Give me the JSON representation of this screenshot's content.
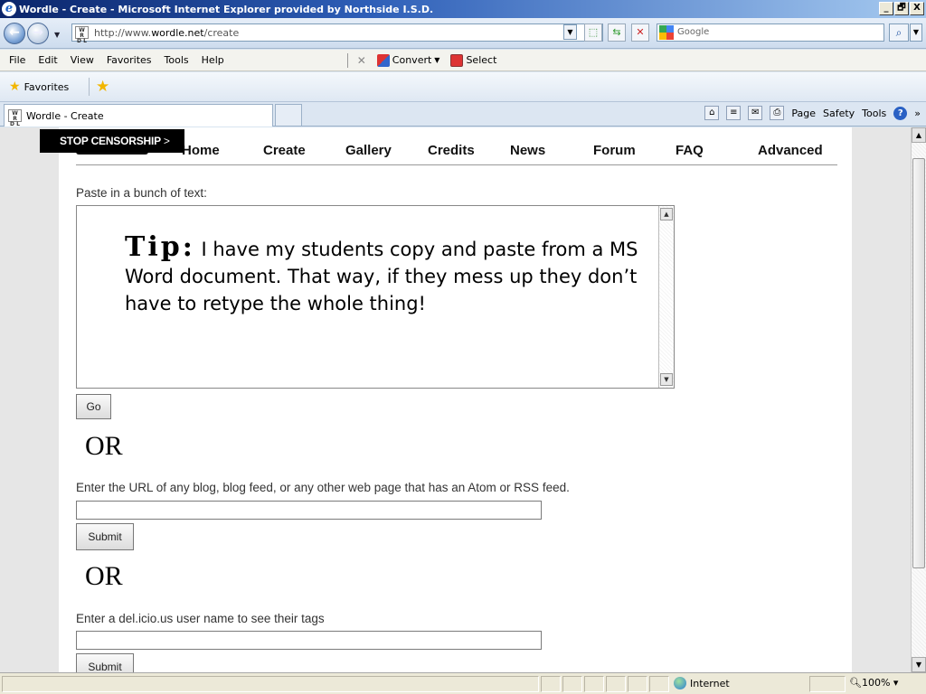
{
  "window": {
    "title": "Wordle - Create - Microsoft Internet Explorer provided by Northside I.S.D.",
    "minimize": "_",
    "maximize": "🗗",
    "close": "X"
  },
  "addressbar": {
    "url_prefix": "http://www.",
    "url_domain": "wordle.net",
    "url_path": "/create",
    "search_placeholder": "Google"
  },
  "menu": {
    "items": [
      "File",
      "Edit",
      "View",
      "Favorites",
      "Tools",
      "Help"
    ],
    "convert_label": "Convert",
    "select_label": "Select"
  },
  "favorites": {
    "label": "Favorites"
  },
  "tab": {
    "title": "Wordle - Create"
  },
  "commandbar": {
    "page": "Page",
    "safety": "Safety",
    "tools": "Tools",
    "more": "»"
  },
  "site": {
    "badge": "STOP CENSORSHIP",
    "badge_chevron": ">",
    "nav": [
      "Home",
      "Create",
      "Gallery",
      "Credits",
      "News",
      "Forum",
      "FAQ",
      "Advanced"
    ]
  },
  "form": {
    "paste_label": "Paste in a bunch of text:",
    "tip_word": "Tip:",
    "tip_text": "I have my students copy and paste from a MS Word document.  That way, if they mess up they don’t have to retype the whole thing!",
    "go_button": "Go",
    "or1": "OR",
    "url_label": "Enter the URL of any blog, blog feed, or any other web page that has an Atom or RSS feed.",
    "url_value": "",
    "submit1": "Submit",
    "or2": "OR",
    "delicious_label": "Enter a del.icio.us user name to see their tags",
    "delicious_value": "",
    "submit2": "Submit"
  },
  "status": {
    "zone": "Internet",
    "zoom": "100%"
  }
}
